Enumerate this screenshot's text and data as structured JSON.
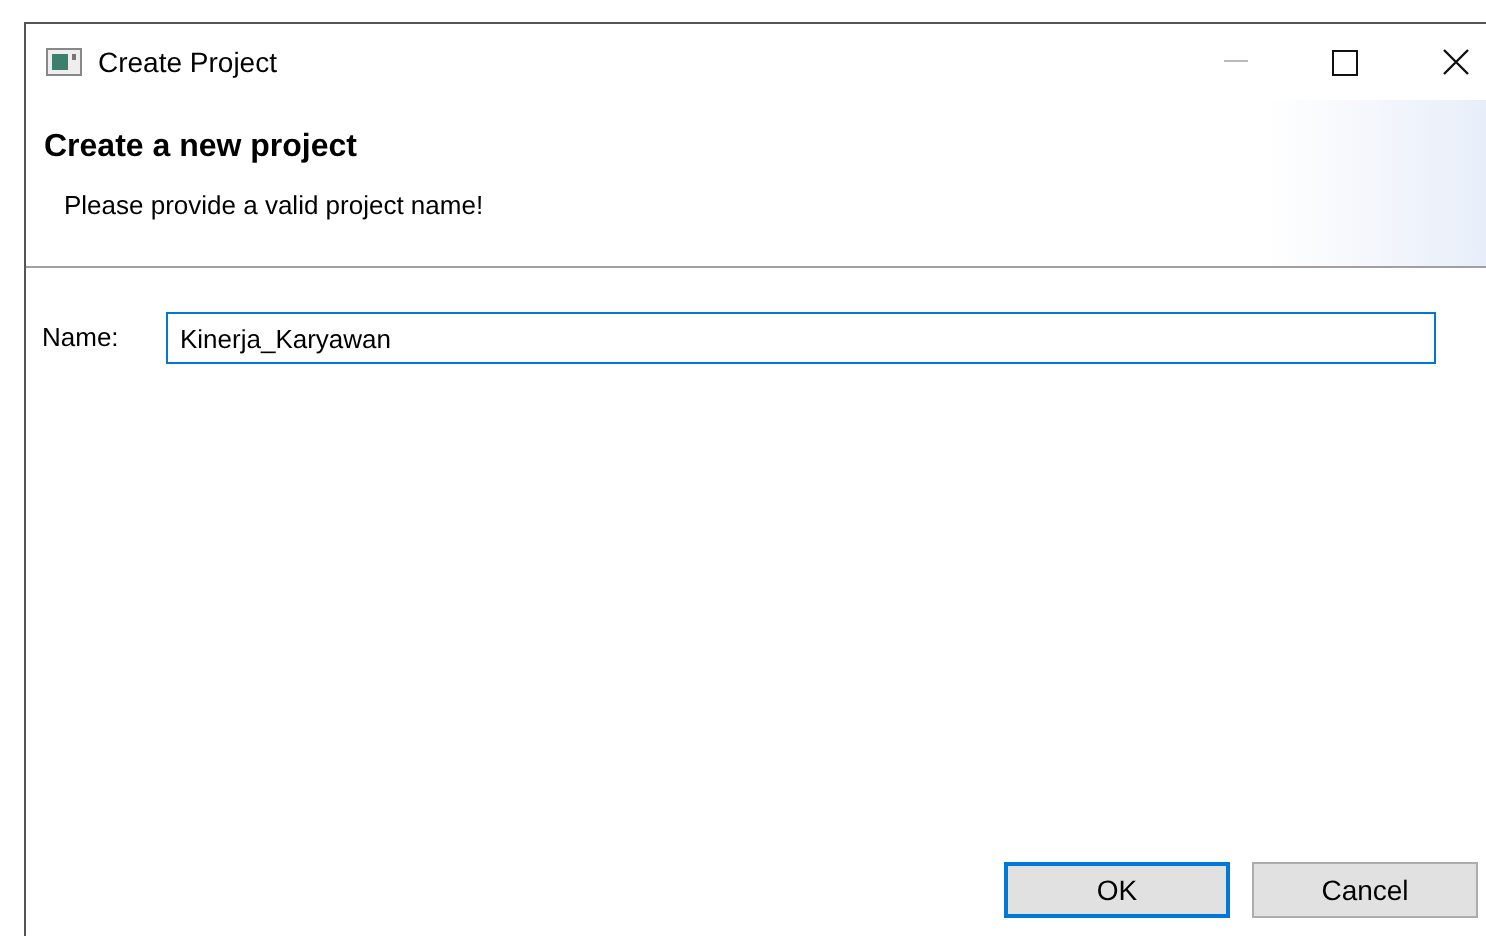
{
  "window": {
    "title": "Create Project"
  },
  "header": {
    "title": "Create a new project",
    "message": "Please provide a valid project name!"
  },
  "name_field": {
    "label": "Name:",
    "value": "Kinerja_Karyawan",
    "focused": true
  },
  "buttons": [
    {
      "label": "OK",
      "default": true
    },
    {
      "label": "Cancel",
      "default": false
    }
  ]
}
